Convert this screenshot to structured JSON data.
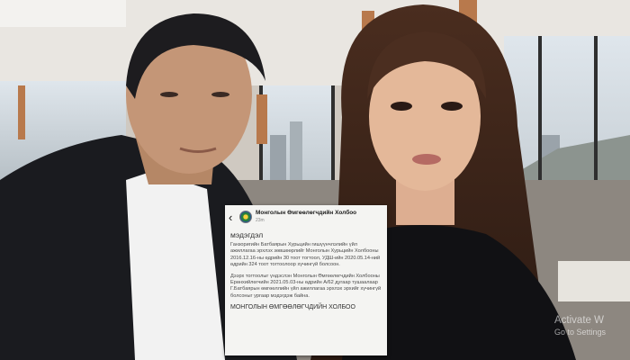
{
  "post": {
    "page_name": "Монголын Өмгөөлөгчдийн Холбоо",
    "time": "23m",
    "title": "мэдэгдэл",
    "paragraph_1": "Ганзоригийн Батбаярын Хурьцийн гишүүнчлэлийн үйл ажиллагаа эрхлэх зөвшөөрлийг Монголын Хурьцийн Холбооны 2016.12.16-ны өдрийн 30 тоот тогтоол, УДШ-ийн 2020.05.14-ний өдрийн 324 тоот тогтоолоор хүчингүй болсоон.",
    "paragraph_2": "Дээрх тогтоолыг үндэслэн Монголын Өмгөөлөгчдийн Холбооны Ерөнхийлөгчийн 2021.05.03-ны өдрийн А/62 дугаар тушаалаар Г.Батбаярын өмгөөллийн үйл ажиллагаа эрхлэх эрхийг хүчингүй болсоныг ургаар мэдэгдэж байна.",
    "signature": "МОНГОЛЫН ӨМГӨӨЛӨГЧДИЙН ХОЛБОО"
  },
  "watermark": {
    "line1": "Activate W",
    "line2": "Go to Settings"
  }
}
